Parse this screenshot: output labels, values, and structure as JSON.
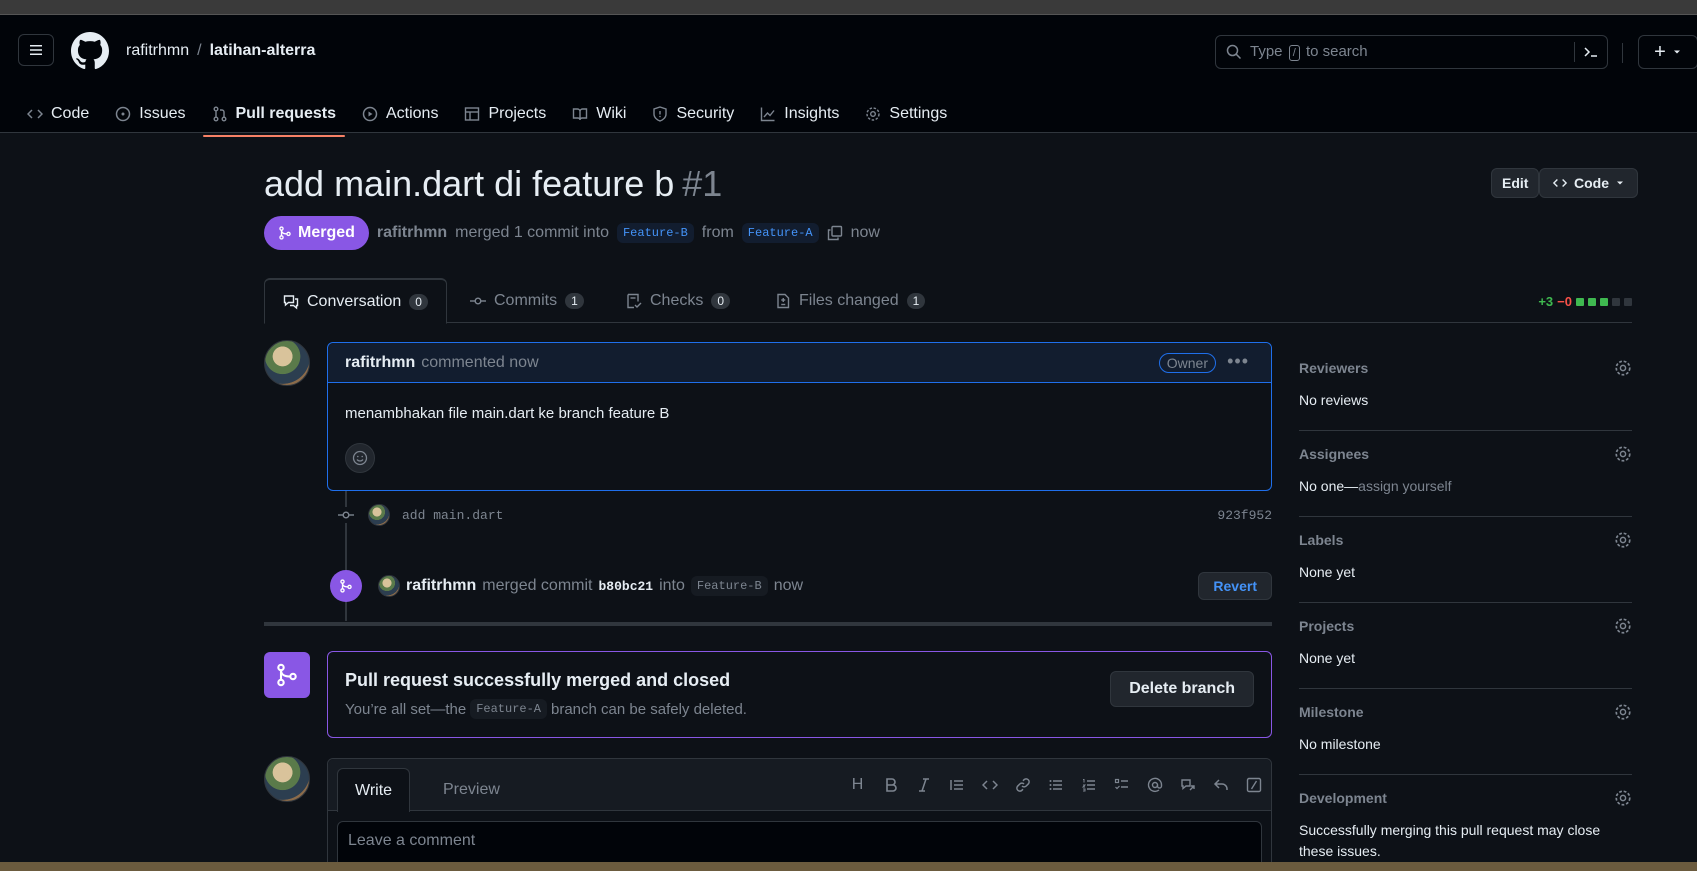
{
  "header": {
    "owner": "rafitrhmn",
    "separator": "/",
    "repo": "latihan-alterra",
    "search_prefix": "Type",
    "search_slash": "/",
    "search_suffix": "to search",
    "plus": "+"
  },
  "nav": [
    {
      "label": "Code",
      "icon": "code-icon"
    },
    {
      "label": "Issues",
      "icon": "issue-icon"
    },
    {
      "label": "Pull requests",
      "icon": "pull-request-icon",
      "active": true
    },
    {
      "label": "Actions",
      "icon": "play-icon"
    },
    {
      "label": "Projects",
      "icon": "table-icon"
    },
    {
      "label": "Wiki",
      "icon": "book-icon"
    },
    {
      "label": "Security",
      "icon": "shield-icon"
    },
    {
      "label": "Insights",
      "icon": "graph-icon"
    },
    {
      "label": "Settings",
      "icon": "gear-icon"
    }
  ],
  "pr": {
    "title": "add main.dart di feature b",
    "number": "#1",
    "edit_label": "Edit",
    "code_label": "Code",
    "status": "Merged",
    "author": "rafitrhmn",
    "merged_text": "merged 1 commit into",
    "base_branch": "Feature-B",
    "from_text": "from",
    "head_branch": "Feature-A",
    "time": "now"
  },
  "tabs": [
    {
      "label": "Conversation",
      "count": "0"
    },
    {
      "label": "Commits",
      "count": "1"
    },
    {
      "label": "Checks",
      "count": "0"
    },
    {
      "label": "Files changed",
      "count": "1"
    }
  ],
  "diffstat": {
    "additions": "+3",
    "deletions": "−0"
  },
  "comment": {
    "author": "rafitrhmn",
    "action": "commented now",
    "badge": "Owner",
    "body": "menambhakan file main.dart ke branch feature B"
  },
  "commit": {
    "message": "add main.dart",
    "sha": "923f952"
  },
  "merge_event": {
    "user": "rafitrhmn",
    "text": "merged commit",
    "sha": "b80bc21",
    "into": "into",
    "branch": "Feature-B",
    "time": "now",
    "revert_label": "Revert"
  },
  "merged_box": {
    "title": "Pull request successfully merged and closed",
    "sub_before": "You’re all set—the",
    "branch": "Feature-A",
    "sub_after": "branch can be safely deleted.",
    "delete_label": "Delete branch"
  },
  "editor": {
    "write_tab": "Write",
    "preview_tab": "Preview",
    "heading_label": "H",
    "placeholder": "Leave a comment"
  },
  "sidebar": [
    {
      "heading": "Reviewers",
      "value": "No reviews"
    },
    {
      "heading": "Assignees",
      "value": "No one—",
      "muted": "assign yourself"
    },
    {
      "heading": "Labels",
      "value": "None yet"
    },
    {
      "heading": "Projects",
      "value": "None yet"
    },
    {
      "heading": "Milestone",
      "value": "No milestone"
    },
    {
      "heading": "Development",
      "value": "Successfully merging this pull request may close these issues."
    }
  ],
  "colors": {
    "merged": "#8957e5",
    "accent": "#4493f8",
    "add": "#3fb950",
    "del": "#f85149"
  }
}
